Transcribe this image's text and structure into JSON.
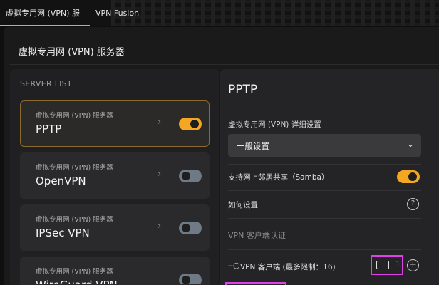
{
  "tabs": [
    {
      "label": "虚拟专用网 (VPN) 服务器"
    },
    {
      "label": "VPN Fusion"
    }
  ],
  "page_title": "虚拟专用网 (VPN) 服务器",
  "server_list": {
    "heading": "SERVER LIST",
    "items": [
      {
        "subtitle": "虚拟专用网 (VPN) 服务器",
        "name": "PPTP",
        "enabled": true
      },
      {
        "subtitle": "虚拟专用网 (VPN) 服务器",
        "name": "OpenVPN",
        "enabled": false
      },
      {
        "subtitle": "虚拟专用网 (VPN) 服务器",
        "name": "IPSec VPN",
        "enabled": false
      },
      {
        "subtitle": "虚拟专用网 (VPN) 服务器",
        "name": "WireGuard VPN",
        "enabled": false
      }
    ]
  },
  "detail": {
    "title": "PPTP",
    "settings_label": "虚拟专用网 (VPN) 详细设置",
    "settings_select_value": "一般设置",
    "samba_label": "支持网上邻居共享（Samba）",
    "samba_enabled": true,
    "how_to_label": "如何设置",
    "client_auth_label": "VPN 客户端认证",
    "client_label": "VPN 客户端 (最多限制：16)",
    "client_count": "1"
  },
  "colors": {
    "accent": "#f5a623",
    "highlight": "#e040e8"
  },
  "icons": {
    "chevron": "chevron-right-icon",
    "caret": "chevron-down-icon",
    "help": "help-circle-icon",
    "key": "key-icon",
    "device": "device-icon",
    "add": "add-circle-icon"
  }
}
